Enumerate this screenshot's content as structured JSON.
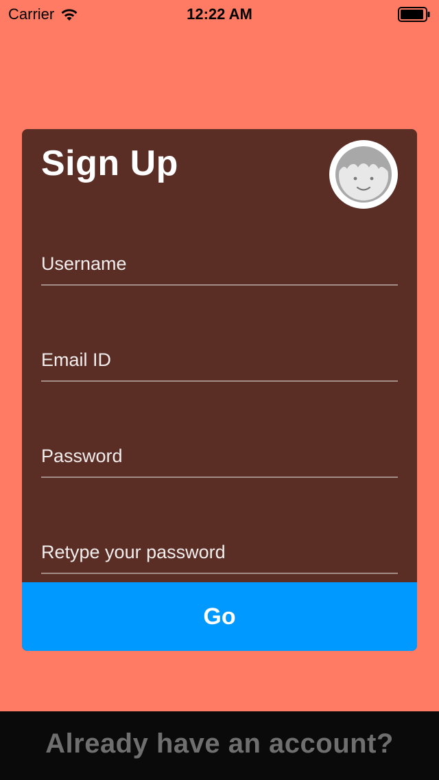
{
  "status_bar": {
    "carrier": "Carrier",
    "time": "12:22 AM",
    "wifi_icon": "wifi-icon",
    "battery_icon": "battery-icon"
  },
  "signup": {
    "title": "Sign Up",
    "avatar_icon": "avatar-face-icon",
    "fields": [
      {
        "placeholder": "Username",
        "value": ""
      },
      {
        "placeholder": "Email ID",
        "value": ""
      },
      {
        "placeholder": "Password",
        "value": ""
      },
      {
        "placeholder": "Retype your password",
        "value": ""
      }
    ],
    "submit_label": "Go"
  },
  "footer": {
    "login_link": "Already have an account?"
  },
  "colors": {
    "background": "#FF7B63",
    "card": "#5A2E25",
    "button": "#0099FF",
    "footer": "#0A0A0A",
    "footer_text": "#6F6F6F"
  }
}
